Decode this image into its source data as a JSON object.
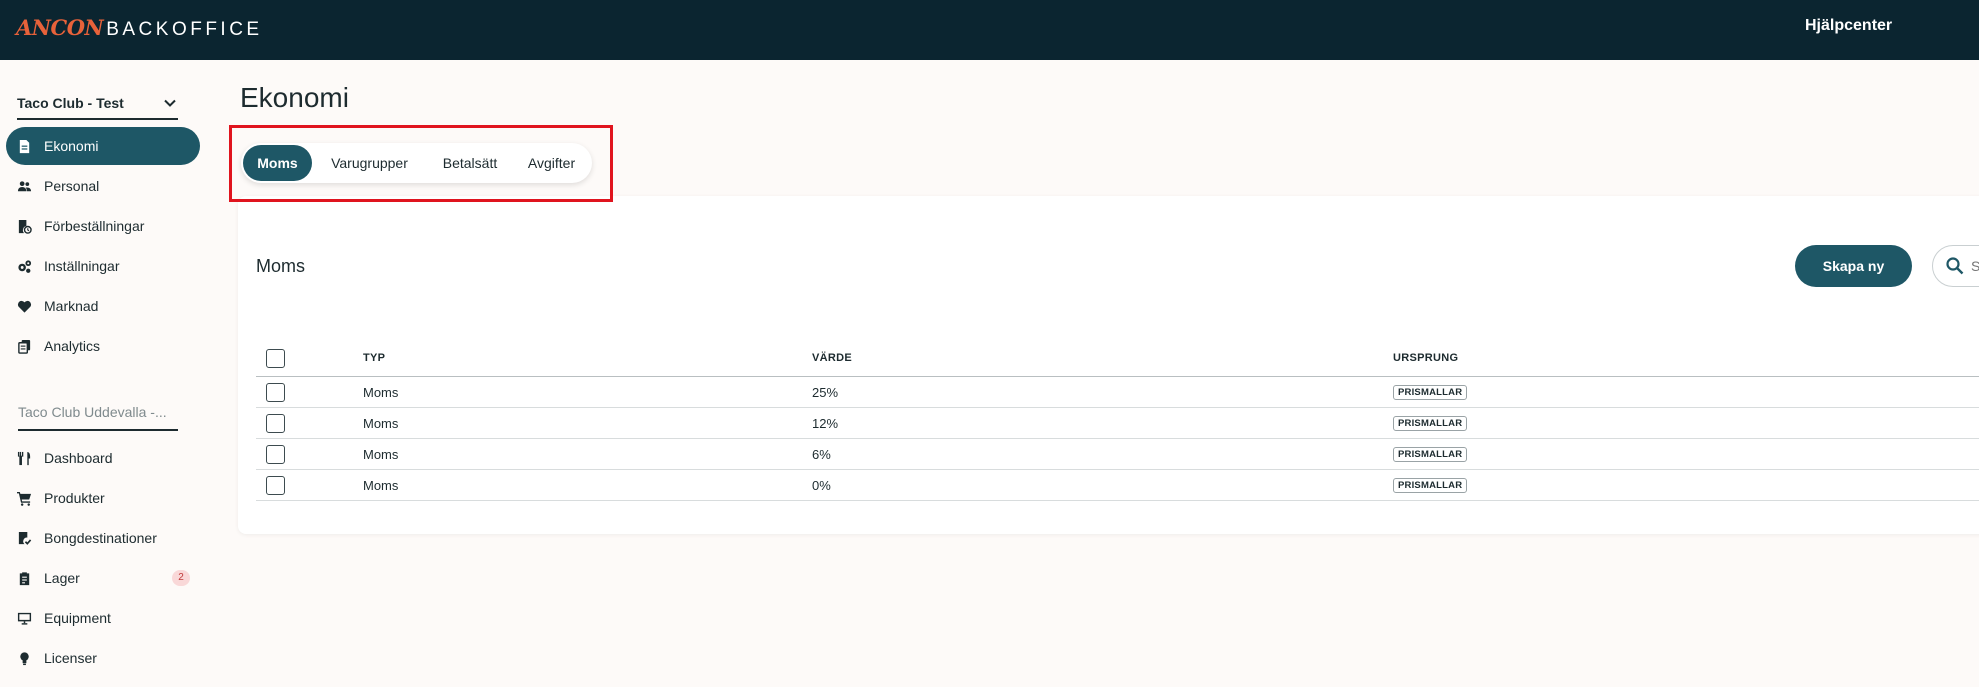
{
  "header": {
    "logo_brand": "ANCON",
    "logo_sub": "BACKOFFICE",
    "help_label": "Hjälpcenter"
  },
  "sidebar": {
    "org_label": "Taco Club - Test",
    "items": [
      {
        "label": "Ekonomi",
        "icon": "document-icon"
      },
      {
        "label": "Personal",
        "icon": "people-icon"
      },
      {
        "label": "Förbeställningar",
        "icon": "preorder-icon"
      },
      {
        "label": "Inställningar",
        "icon": "gears-icon"
      },
      {
        "label": "Marknad",
        "icon": "heart-icon"
      },
      {
        "label": "Analytics",
        "icon": "analytics-icon"
      }
    ],
    "section_label": "Taco Club Uddevalla -...",
    "venue_items": [
      {
        "label": "Dashboard",
        "icon": "cutlery-icon"
      },
      {
        "label": "Produkter",
        "icon": "cart-icon"
      },
      {
        "label": "Bongdestinationer",
        "icon": "receipt-icon"
      },
      {
        "label": "Lager",
        "icon": "clipboard-icon",
        "badge": "2"
      },
      {
        "label": "Equipment",
        "icon": "monitor-icon"
      },
      {
        "label": "Licenser",
        "icon": "bulb-icon"
      }
    ]
  },
  "main": {
    "page_title": "Ekonomi",
    "tabs": [
      {
        "label": "Moms"
      },
      {
        "label": "Varugrupper"
      },
      {
        "label": "Betalsätt"
      },
      {
        "label": "Avgifter"
      }
    ],
    "card_title": "Moms",
    "create_label": "Skapa ny",
    "search_placeholder": "Sök",
    "table": {
      "columns": [
        "TYP",
        "VÄRDE",
        "URSPRUNG"
      ],
      "rows": [
        {
          "type": "Moms",
          "value": "25%",
          "origin": "PRISMALLAR"
        },
        {
          "type": "Moms",
          "value": "12%",
          "origin": "PRISMALLAR"
        },
        {
          "type": "Moms",
          "value": "6%",
          "origin": "PRISMALLAR"
        },
        {
          "type": "Moms",
          "value": "0%",
          "origin": "PRISMALLAR"
        }
      ]
    }
  },
  "colors": {
    "topbar": "#0b2530",
    "accent": "#1e5766",
    "brand": "#e8623a",
    "highlight": "#e0141e"
  }
}
